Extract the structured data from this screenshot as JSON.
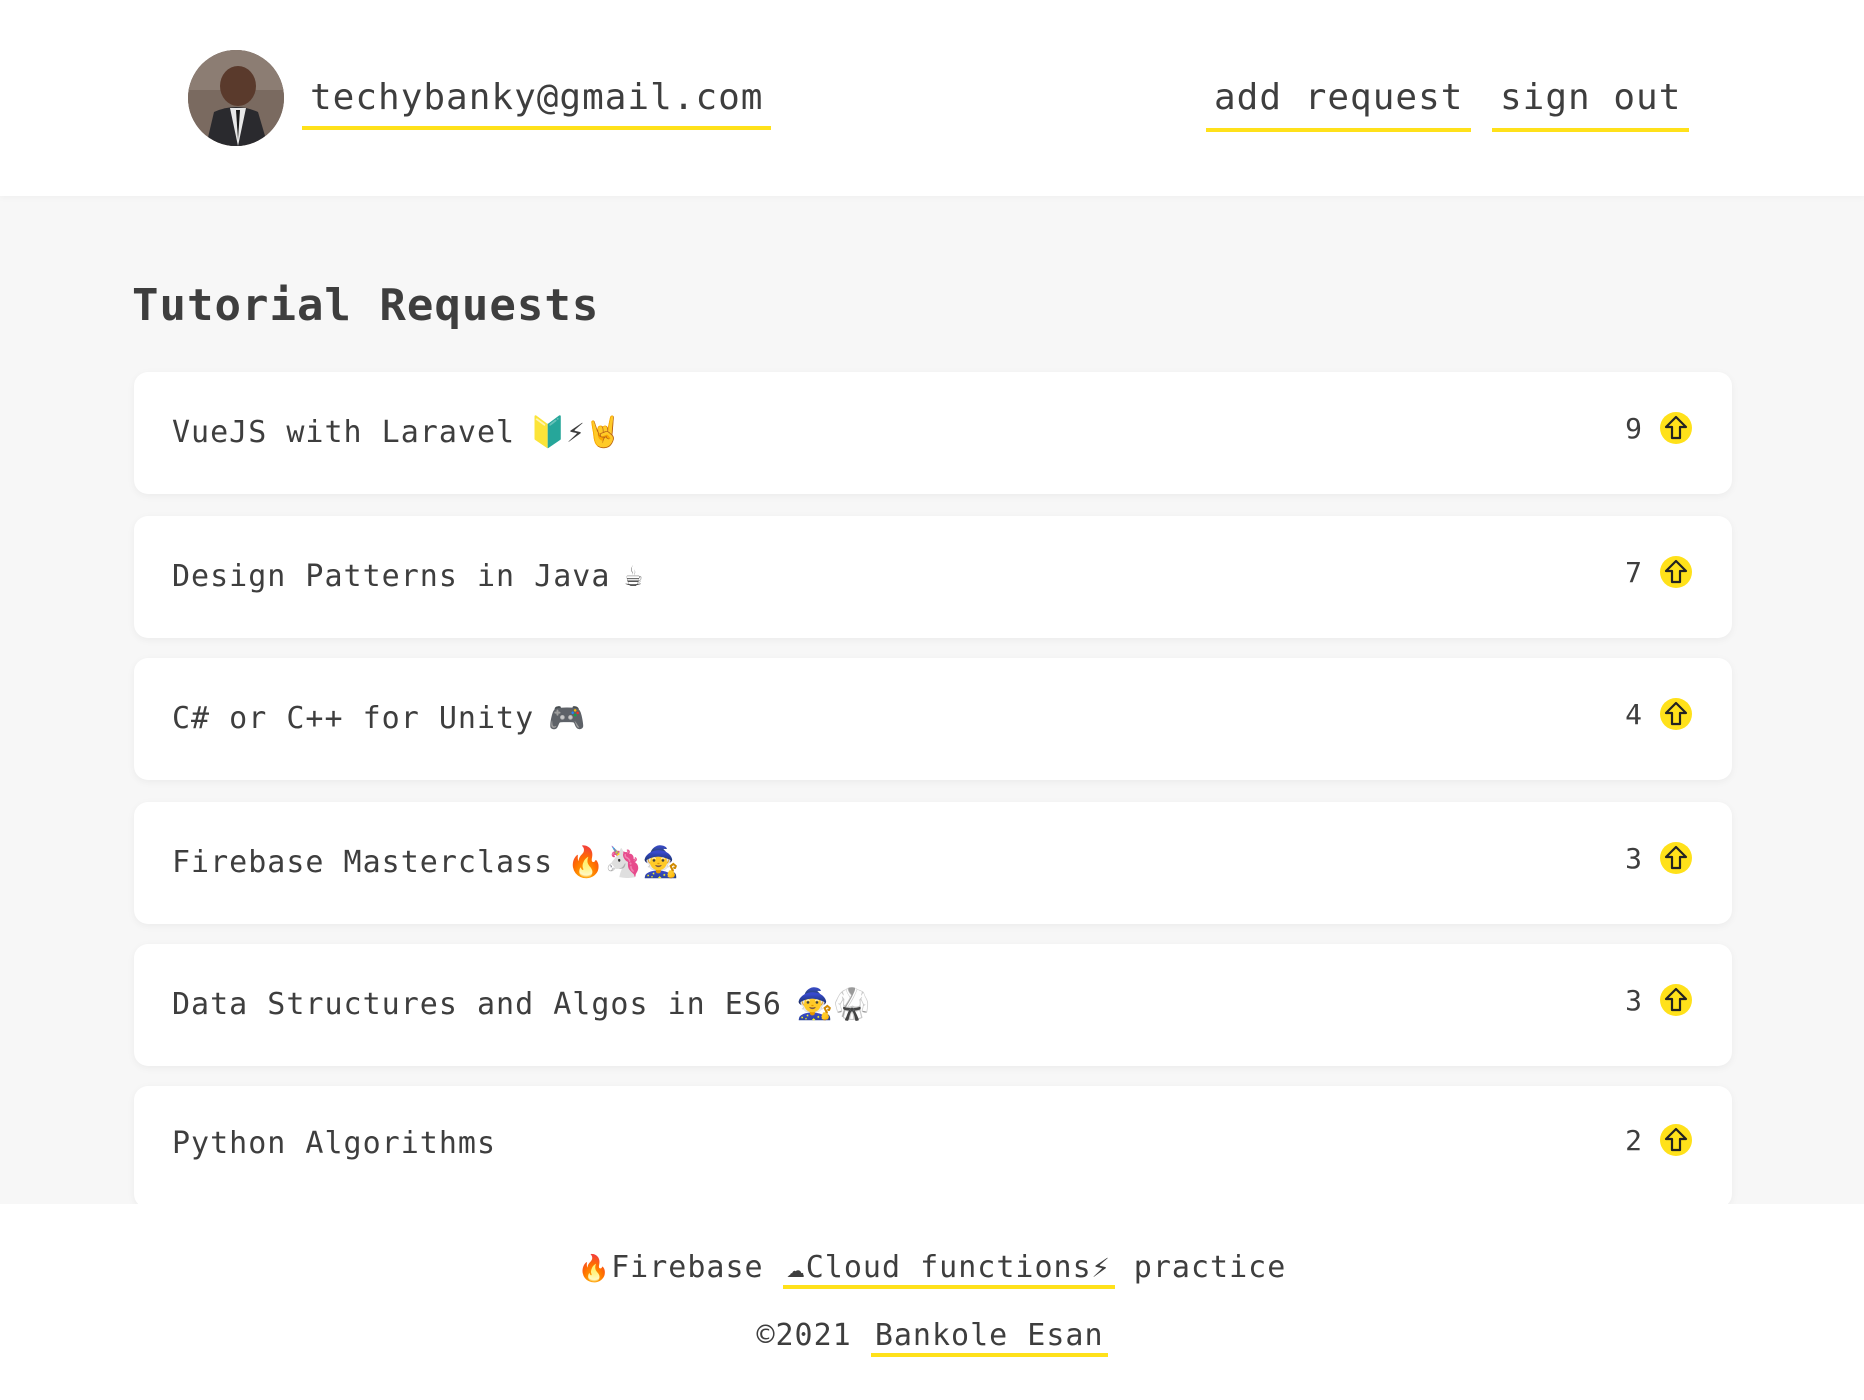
{
  "header": {
    "user_email": "techybanky@gmail.com",
    "nav": {
      "add_request": "add request",
      "sign_out": "sign out"
    }
  },
  "main": {
    "title": "Tutorial Requests",
    "requests": [
      {
        "text": "VueJS with Laravel",
        "emoji": "🔰⚡🤘",
        "votes": "9"
      },
      {
        "text": "Design Patterns in Java",
        "emoji": "☕",
        "votes": "7"
      },
      {
        "text": "C# or C++ for Unity",
        "emoji": "🎮",
        "votes": "4"
      },
      {
        "text": "Firebase Masterclass",
        "emoji": "🔥🦄🧙",
        "votes": "3"
      },
      {
        "text": "Data Structures and Algos in ES6",
        "emoji": "🧙🥋",
        "votes": "3"
      },
      {
        "text": "Python Algorithms",
        "emoji": "",
        "votes": "2"
      }
    ]
  },
  "footer": {
    "firebase_logo": "🔥",
    "firebase_label": "Firebase",
    "cloud_functions_label": "☁Cloud functions⚡",
    "practice_label": "practice",
    "copyright": "©2021",
    "author": "Bankole Esan"
  },
  "colors": {
    "accent": "#ffe11a",
    "text": "#3e3e3e",
    "background": "#f7f7f7",
    "card": "#ffffff"
  },
  "icons": {
    "upvote": "upvote-arrow-icon",
    "avatar": "user-avatar"
  }
}
